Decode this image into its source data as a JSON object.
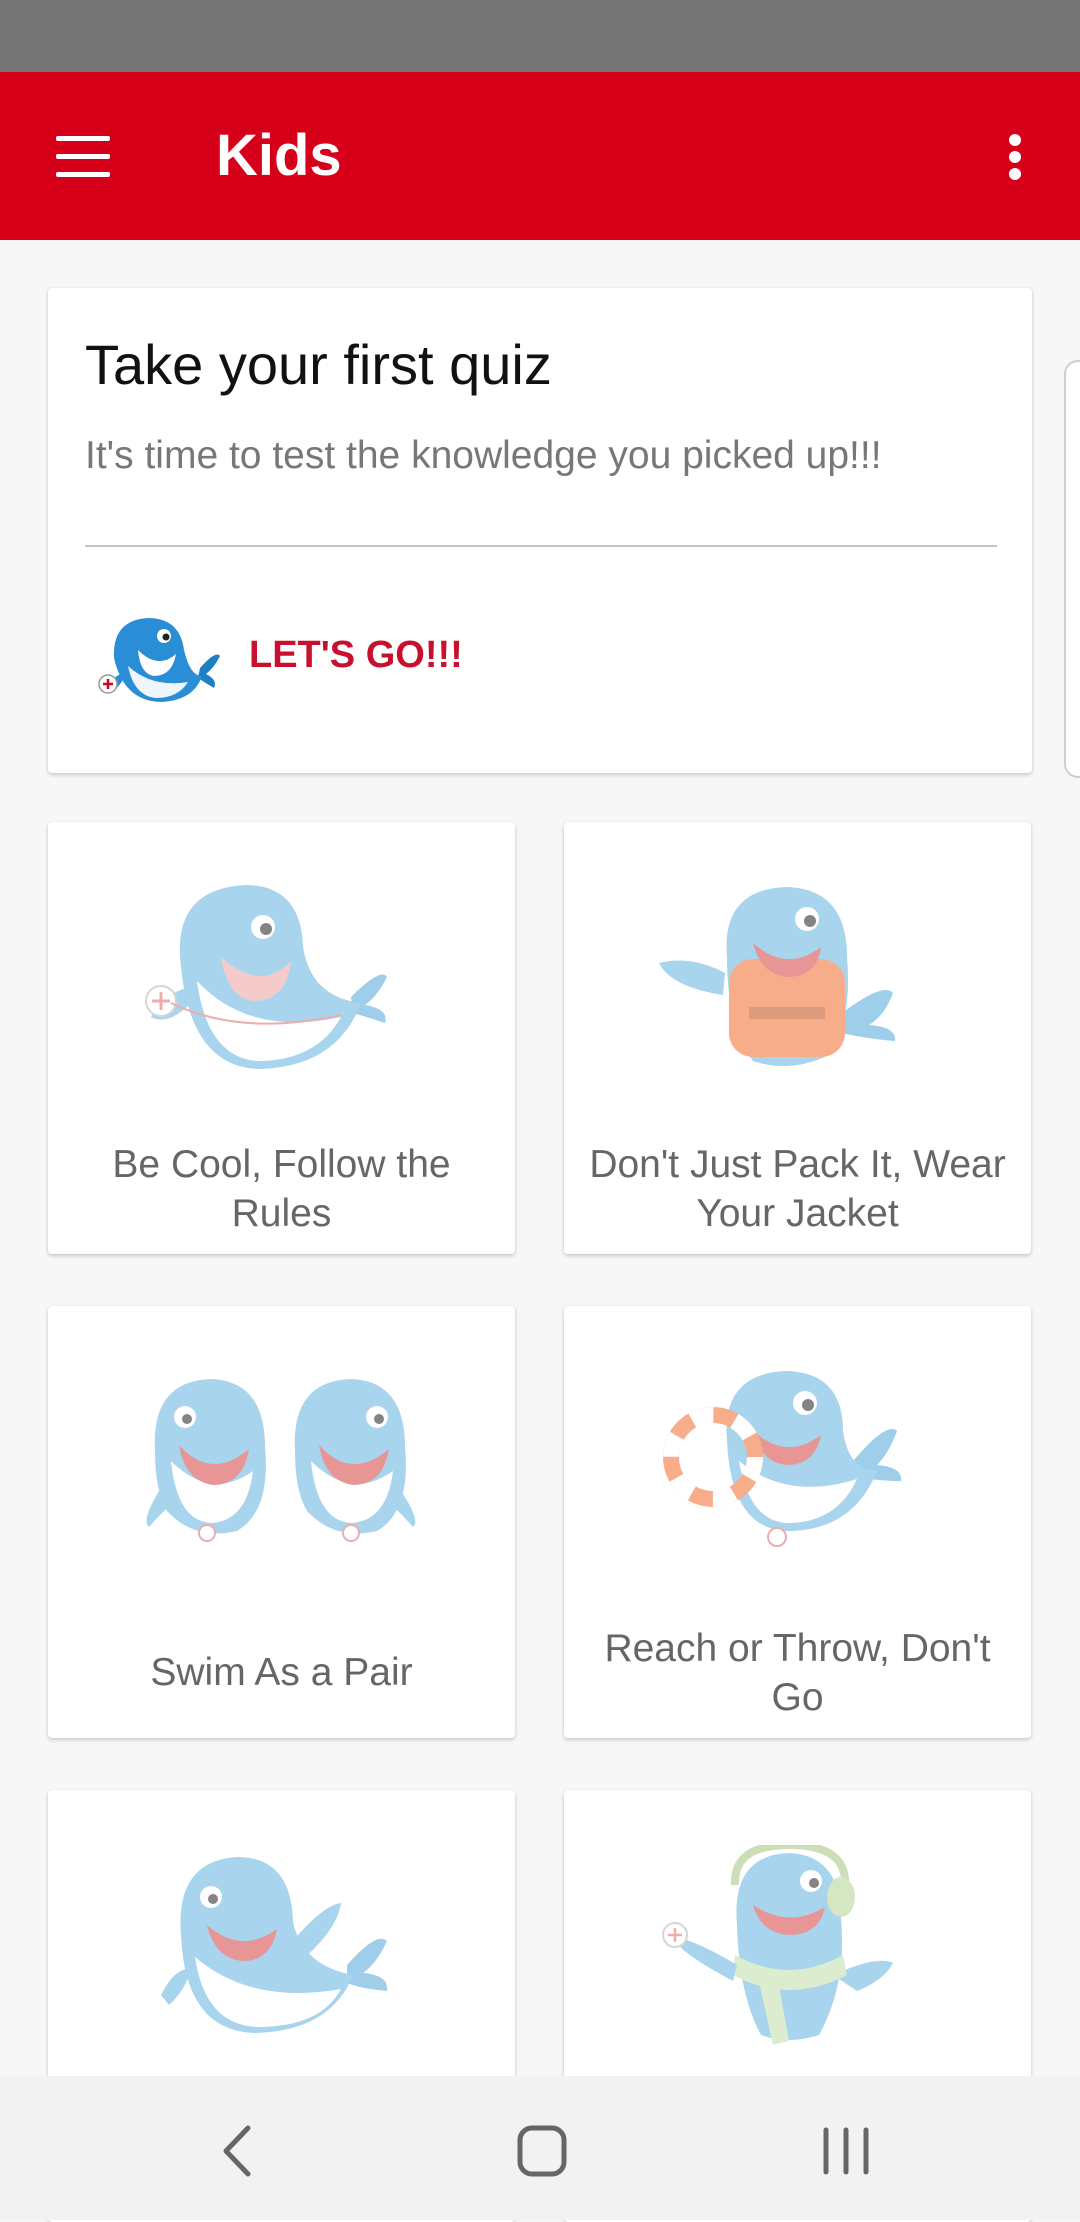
{
  "app_bar": {
    "title": "Kids"
  },
  "quiz_card": {
    "title": "Take your first quiz",
    "subtitle": "It's time to test the knowledge you picked up!!!",
    "action_label": "LET'S GO!!!"
  },
  "topics": [
    {
      "label": "Be Cool, Follow the Rules",
      "icon": "whale-lifeguard-icon"
    },
    {
      "label": "Don't Just Pack It, Wear Your Jacket",
      "icon": "whale-life-jacket-icon"
    },
    {
      "label": "Swim As a Pair",
      "icon": "whale-pair-icon"
    },
    {
      "label": "Reach or Throw, Don't Go",
      "icon": "whale-life-ring-icon"
    },
    {
      "label": "",
      "icon": "whale-waving-icon"
    },
    {
      "label": "",
      "icon": "whale-headphones-scarf-icon"
    }
  ],
  "colors": {
    "brand_red": "#d7001b",
    "action_red": "#c8102e",
    "whale_blue": "#8cc8e8"
  }
}
